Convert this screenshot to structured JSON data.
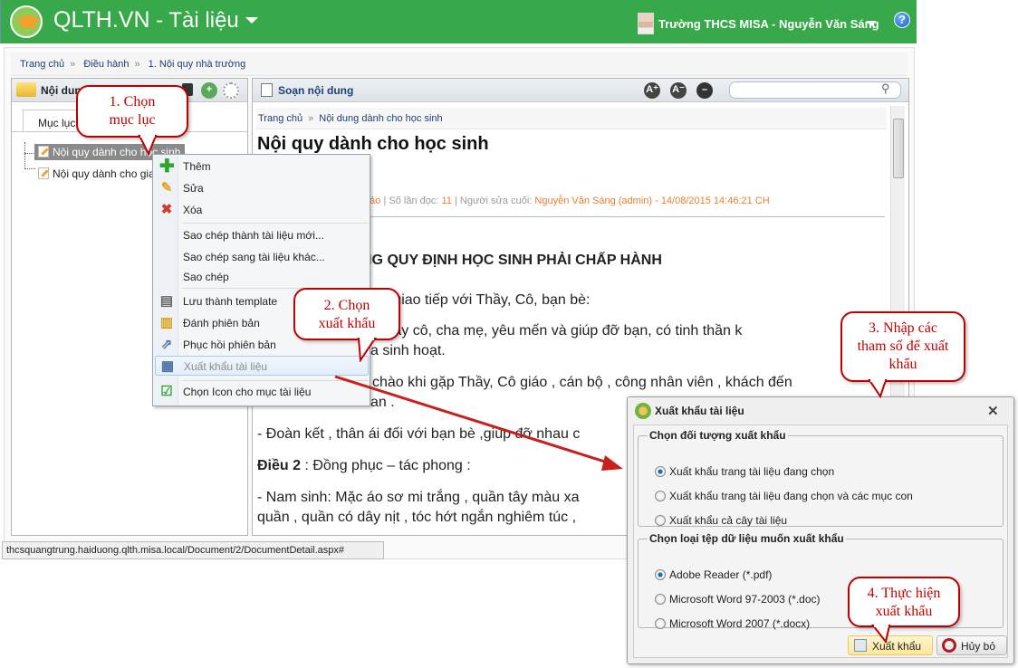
{
  "header": {
    "app_name": "QLTH.VN",
    "module": " - Tài liệu",
    "user": "Trường THCS MISA - Nguyễn Văn Sáng",
    "help": "?"
  },
  "breadcrumb": [
    "Trang chủ",
    "Điều hành",
    "1. Nội quy nhà trường"
  ],
  "breadcrumb_sep": "»",
  "left_panel": {
    "title": "Nội dung",
    "tab": "Mục lục",
    "tree": [
      "Nội quy dành cho học sinh",
      "Nội quy dành cho gia"
    ]
  },
  "right_panel": {
    "title": "Soạn nội dung",
    "search_placeholder": ""
  },
  "document": {
    "breadcrumb": [
      "Trang chủ",
      "Nội dung dành cho học sinh"
    ],
    "title": "Nội quy dành cho học sinh",
    "meta": {
      "status_tail": "thảo",
      "reads_label": "Số lần đọc:",
      "reads": "11",
      "editor_label": "Người sửa cuối:",
      "editor": "Nguyễn Văn Sáng (admin) - 14/08/2015 14:46:21 CH"
    },
    "lines": {
      "heading": "NG QUY ĐỊNH HỌC SINH PHẢI CHẤP HÀNH",
      "l1": "ư xử giao tiếp với Thầy, Cô, bạn bè:",
      "l2": "lời thầy cô, cha mẹ, yêu mến và giúp đỡ bạn, có tinh thần k",
      "l3": "a sinh hoạt.",
      "l4": "chào khi gặp Thầy, Cô giáo , cán bộ , công nhân viên , khách đến",
      "l5": "an .",
      "l6": "- Đoàn kết , thân ái đối với bạn bè ,giúp đỡ nhau c",
      "l7_bold": "Điều 2",
      "l7": " : Đồng phục – tác phong :",
      "l8": "- Nam sinh:  Mặc áo sơ mi trắng , quần tây màu xa",
      "l9": "quần , quần có dây nịt , tóc hớt ngắn nghiêm túc ,"
    }
  },
  "status_bar": "thcsquangtrung.haiduong.qlth.misa.local/Document/2/DocumentDetail.aspx#",
  "context_menu": {
    "items": [
      "Thêm",
      "Sửa",
      "Xóa",
      "Sao chép thành tài liệu mới...",
      "Sao chép sang tài liệu khác...",
      "Sao chép",
      "Lưu thành template",
      "Đánh phiên bản",
      "Phục hồi phiên bản",
      "Xuất khẩu tài liệu",
      "Chọn Icon cho mục tài liệu"
    ],
    "highlighted": "Xuất khẩu tài liệu"
  },
  "dialog": {
    "title": "Xuất khẩu tài liệu",
    "close": "✕",
    "group1": {
      "legend": "Chọn đối tượng xuất khẩu",
      "options": [
        "Xuất khẩu trang tài liệu đang chọn",
        "Xuất khẩu trang tài liệu đang chọn và các mục con",
        "Xuất khẩu cả cây tài liệu"
      ],
      "selected": 0
    },
    "group2": {
      "legend": "Chọn loại tệp dữ liệu muốn xuất khẩu",
      "options": [
        "Adobe Reader (*.pdf)",
        "Microsoft Word 97-2003 (*.doc)",
        "Microsoft Word 2007 (*.docx)"
      ],
      "selected": 0
    },
    "export_button": "Xuất khẩu",
    "cancel_button": "Hủy bỏ"
  },
  "callouts": {
    "c1": [
      "1. Chọn",
      "mục lục"
    ],
    "c2": [
      "2. Chọn",
      "xuất khẩu"
    ],
    "c3": [
      "3. Nhập các",
      "tham số để xuất",
      "khẩu"
    ],
    "c4": [
      "4. Thực hiện",
      "xuất khẩu"
    ]
  },
  "colors": {
    "brand_green": "#38a94a",
    "callout_red": "#c00000",
    "meta_orange": "#ee7d2b"
  }
}
